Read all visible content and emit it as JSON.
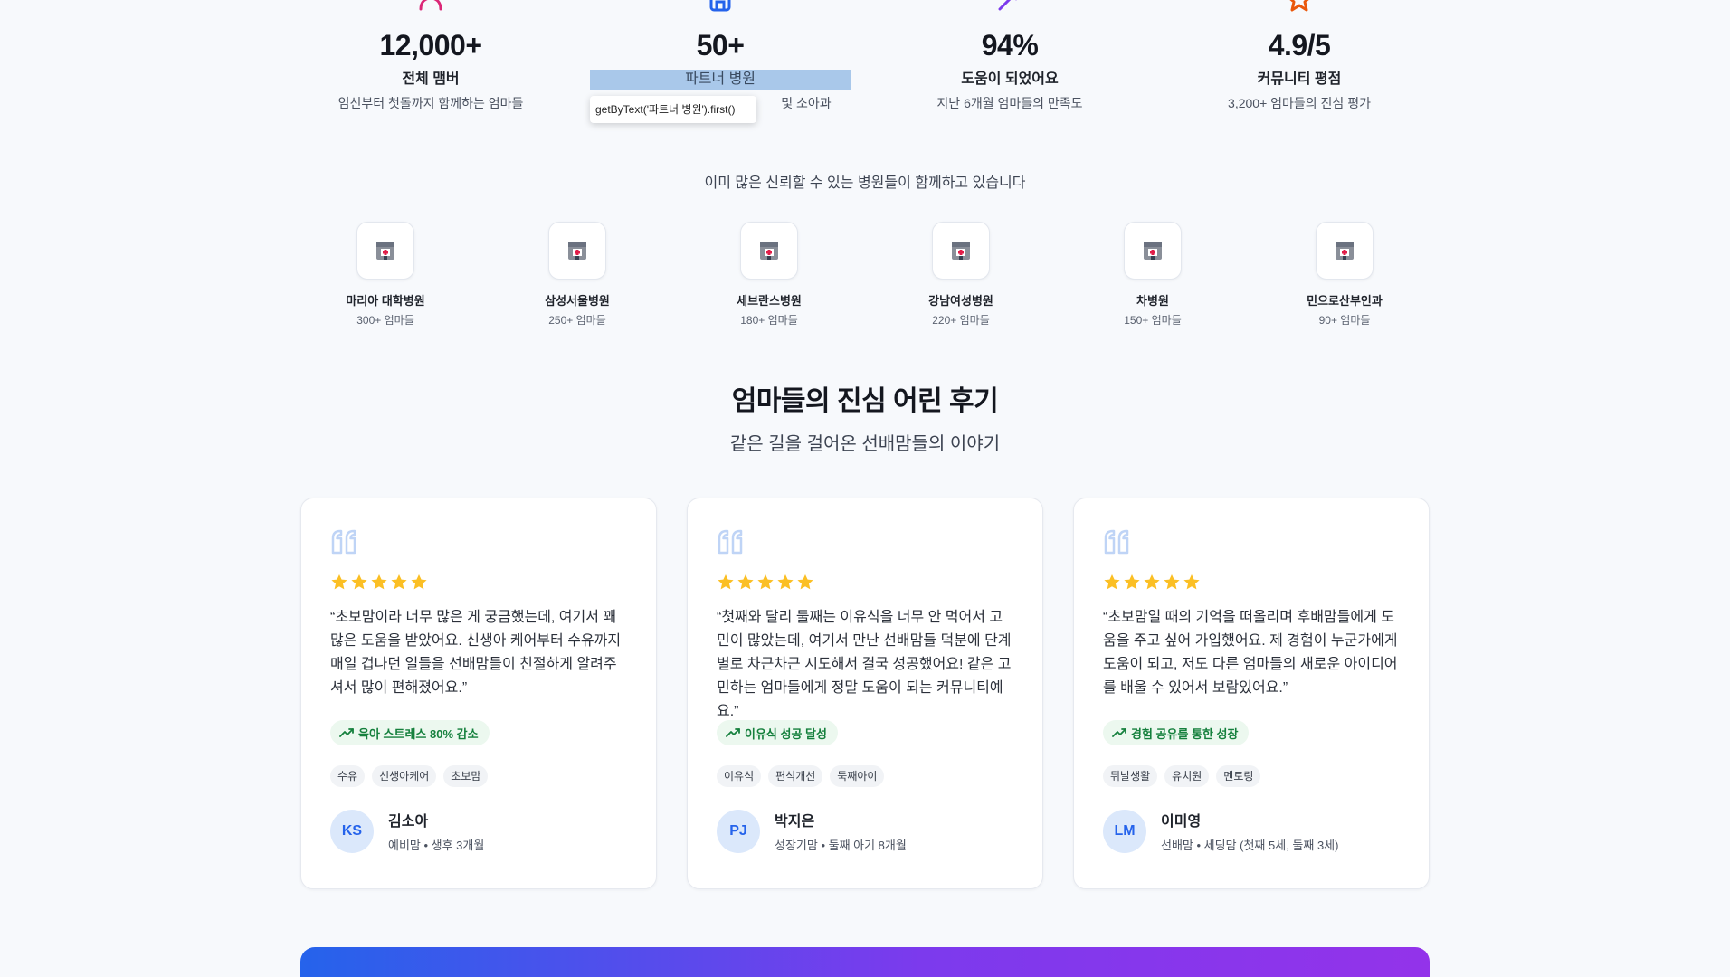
{
  "stats": [
    {
      "icon": "users-icon",
      "value": "12,000+",
      "label": "전체 맴버",
      "desc": "임신부터 첫돌까지 함께하는 엄마들",
      "color": "#db2777"
    },
    {
      "icon": "hospital-building-icon",
      "value": "50+",
      "label": "파트너 병원",
      "desc": "및 소아과",
      "color": "#2563eb"
    },
    {
      "icon": "sparkle-icon",
      "value": "94%",
      "label": "도움이 되었어요",
      "desc": "지난 6개월 엄마들의 만족도",
      "color": "#7c3aed"
    },
    {
      "icon": "star-icon",
      "value": "4.9/5",
      "label": "커뮤니티 평점",
      "desc": "3,200+ 엄마들의 진심 평가",
      "color": "#ea580c"
    }
  ],
  "tooltip": "getByText('파트너 병원').first()",
  "hospitals": {
    "caption": "이미 많은 신뢰할 수 있는 병원들이 함께하고 있습니다",
    "items": [
      {
        "name": "마리아 대학병원",
        "count": "300+ 엄마들"
      },
      {
        "name": "삼성서울병원",
        "count": "250+ 엄마들"
      },
      {
        "name": "세브란스병원",
        "count": "180+ 엄마들"
      },
      {
        "name": "강남여성병원",
        "count": "220+ 엄마들"
      },
      {
        "name": "차병원",
        "count": "150+ 엄마들"
      },
      {
        "name": "민으로산부인과",
        "count": "90+ 엄마들"
      }
    ]
  },
  "reviews": {
    "title": "엄마들의 진심 어린 후기",
    "subtitle": "같은 길을 걸어온 선배맘들의 이야기",
    "items": [
      {
        "rating": 5,
        "text": "“초보맘이라 너무 많은 게 궁금했는데, 여기서 꽤 많은 도움을 받았어요. 신생아 케어부터 수유까지 매일 겁나던 일들을 선배맘들이 친절하게 알려주셔서 많이 편해졌어요.”",
        "outcome": "육아 스트레스 80% 감소",
        "tags": [
          "수유",
          "신생아케어",
          "초보맘"
        ],
        "initials": "KS",
        "name": "김소아",
        "meta": "예비맘 • 생후 3개월"
      },
      {
        "rating": 5,
        "text": "“첫째와 달리 둘째는 이유식을 너무 안 먹어서 고민이 많았는데, 여기서 만난 선배맘들 덕분에 단계별로 차근차근 시도해서 결국 성공했어요! 같은 고민하는 엄마들에게 정말 도움이 되는 커뮤니티예요.”",
        "outcome": "이유식 성공 달성",
        "tags": [
          "이유식",
          "편식개선",
          "둑째아이"
        ],
        "initials": "PJ",
        "name": "박지은",
        "meta": "성장기맘 • 둘째 아기 8개월"
      },
      {
        "rating": 5,
        "text": "“초보맘일 때의 기억을 떠올리며 후배맘들에게 도움을 주고 싶어 가입했어요. 제 경험이 누군가에게 도움이 되고, 저도 다른 엄마들의 새로운 아이디어를 배울 수 있어서 보람있어요.”",
        "outcome": "경험 공유를 통한 성장",
        "tags": [
          "뒤날생활",
          "유치원",
          "멘토링"
        ],
        "initials": "LM",
        "name": "이미영",
        "meta": "선배맘 • 세딩맘 (첫째 5세, 둘째 3세)"
      }
    ]
  },
  "colors": {
    "accent_blue": "#2563eb",
    "star": "#fbbf24",
    "outcome_green": "#15803d",
    "cta_gradient_start": "#2563eb",
    "cta_gradient_end": "#9333ea"
  }
}
